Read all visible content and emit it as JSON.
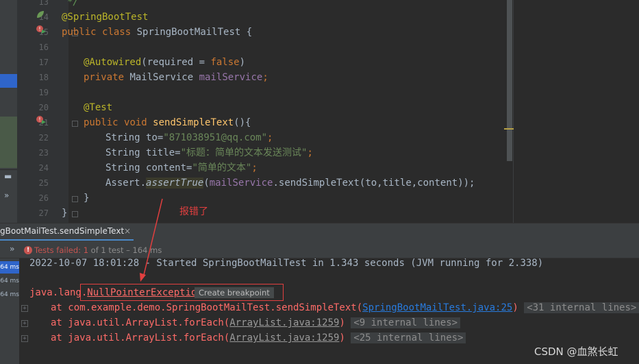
{
  "editor": {
    "lines": [
      {
        "num": "13",
        "text": "*/"
      },
      {
        "num": "14",
        "text": "@SpringBootTest"
      },
      {
        "num": "15",
        "text": "public class SpringBootMailTest {"
      },
      {
        "num": "16",
        "text": ""
      },
      {
        "num": "17",
        "text": "@Autowired(required = false)"
      },
      {
        "num": "18",
        "text": "private MailService mailService;"
      },
      {
        "num": "19",
        "text": ""
      },
      {
        "num": "20",
        "text": "@Test"
      },
      {
        "num": "21",
        "text": "public void sendSimpleText(){"
      },
      {
        "num": "22",
        "text": "String to=\"871038951@qq.com\";"
      },
      {
        "num": "23",
        "text": "String title=\"标题：简单的文本发送测试\";"
      },
      {
        "num": "24",
        "text": "String content=\"简单的文本\";"
      },
      {
        "num": "25",
        "text": "Assert.assertTrue(mailService.sendSimpleText(to,title,content));"
      },
      {
        "num": "26",
        "text": "}"
      },
      {
        "num": "27",
        "text": "}"
      }
    ],
    "tokens": {
      "comment_end": "*/",
      "annot_springboottest": "@SpringBootTest",
      "kw_public": "public",
      "kw_class": "class",
      "class_name": "SpringBootMailTest {",
      "annot_autowired": "@Autowired",
      "autowired_args_open": "(required = ",
      "kw_false": "false",
      "autowired_args_close": ")",
      "kw_private": "private",
      "type_mailservice": "MailService",
      "field_mailservice": "mailService",
      "semicolon": ";",
      "annot_test": "@Test",
      "kw_void": "void",
      "method_name": "sendSimpleText",
      "method_parens": "(){",
      "type_string": "String",
      "var_to": "to=",
      "val_to": "\"871038951@qq.com\"",
      "var_title": "title=",
      "val_title": "\"标题：简单的文本发送测试\"",
      "var_content": "content=",
      "val_content": "\"简单的文本\"",
      "assert_obj": "Assert.",
      "assert_method": "assertTrue",
      "assert_open": "(",
      "assert_field": "mailService",
      "assert_call": ".sendSimpleText(to,title,content));",
      "close_brace": "}"
    }
  },
  "run_panel": {
    "tab_label": "gBootMailTest.sendSimpleText",
    "tab_close": "×",
    "status_chevron": "»",
    "status_failed": "Tests failed: ",
    "status_failed_count": "1",
    "status_rest": " of 1 test – 164 ms",
    "tree_times": [
      "64 ms",
      "64 ms",
      "64 ms"
    ],
    "console": {
      "started_line": "2022-10-07 18:01:28 - Started SpringBootMailTest in 1.343 seconds (JVM running for 2.338)",
      "exception_prefix": "java.lang.",
      "exception_name": "NullPointerException",
      "create_breakpoint": "Create breakpoint",
      "trace": [
        {
          "prefix": "at com.example.demo.SpringBootMailTest.sendSimpleText(",
          "link": "SpringBootMailTest.java:25",
          "suffix": ")",
          "internal": "<31 internal lines>"
        },
        {
          "prefix": "at java.util.ArrayList.forEach(",
          "link": "ArrayList.java:1259",
          "suffix": ")",
          "internal": "<9 internal lines>"
        },
        {
          "prefix": "at java.util.ArrayList.forEach(",
          "link": "ArrayList.java:1259",
          "suffix": ")",
          "internal": "<25 internal lines>"
        }
      ]
    }
  },
  "annotation": {
    "note": "报错了",
    "color": "#e23f3f"
  },
  "watermark": "CSDN @血煞长虹",
  "colors": {
    "keyword": "#cc7832",
    "annotation": "#bbb529",
    "string": "#6a8759",
    "field": "#9876aa",
    "method": "#ffc66d",
    "error": "#ff6b68",
    "link": "#287bde"
  }
}
